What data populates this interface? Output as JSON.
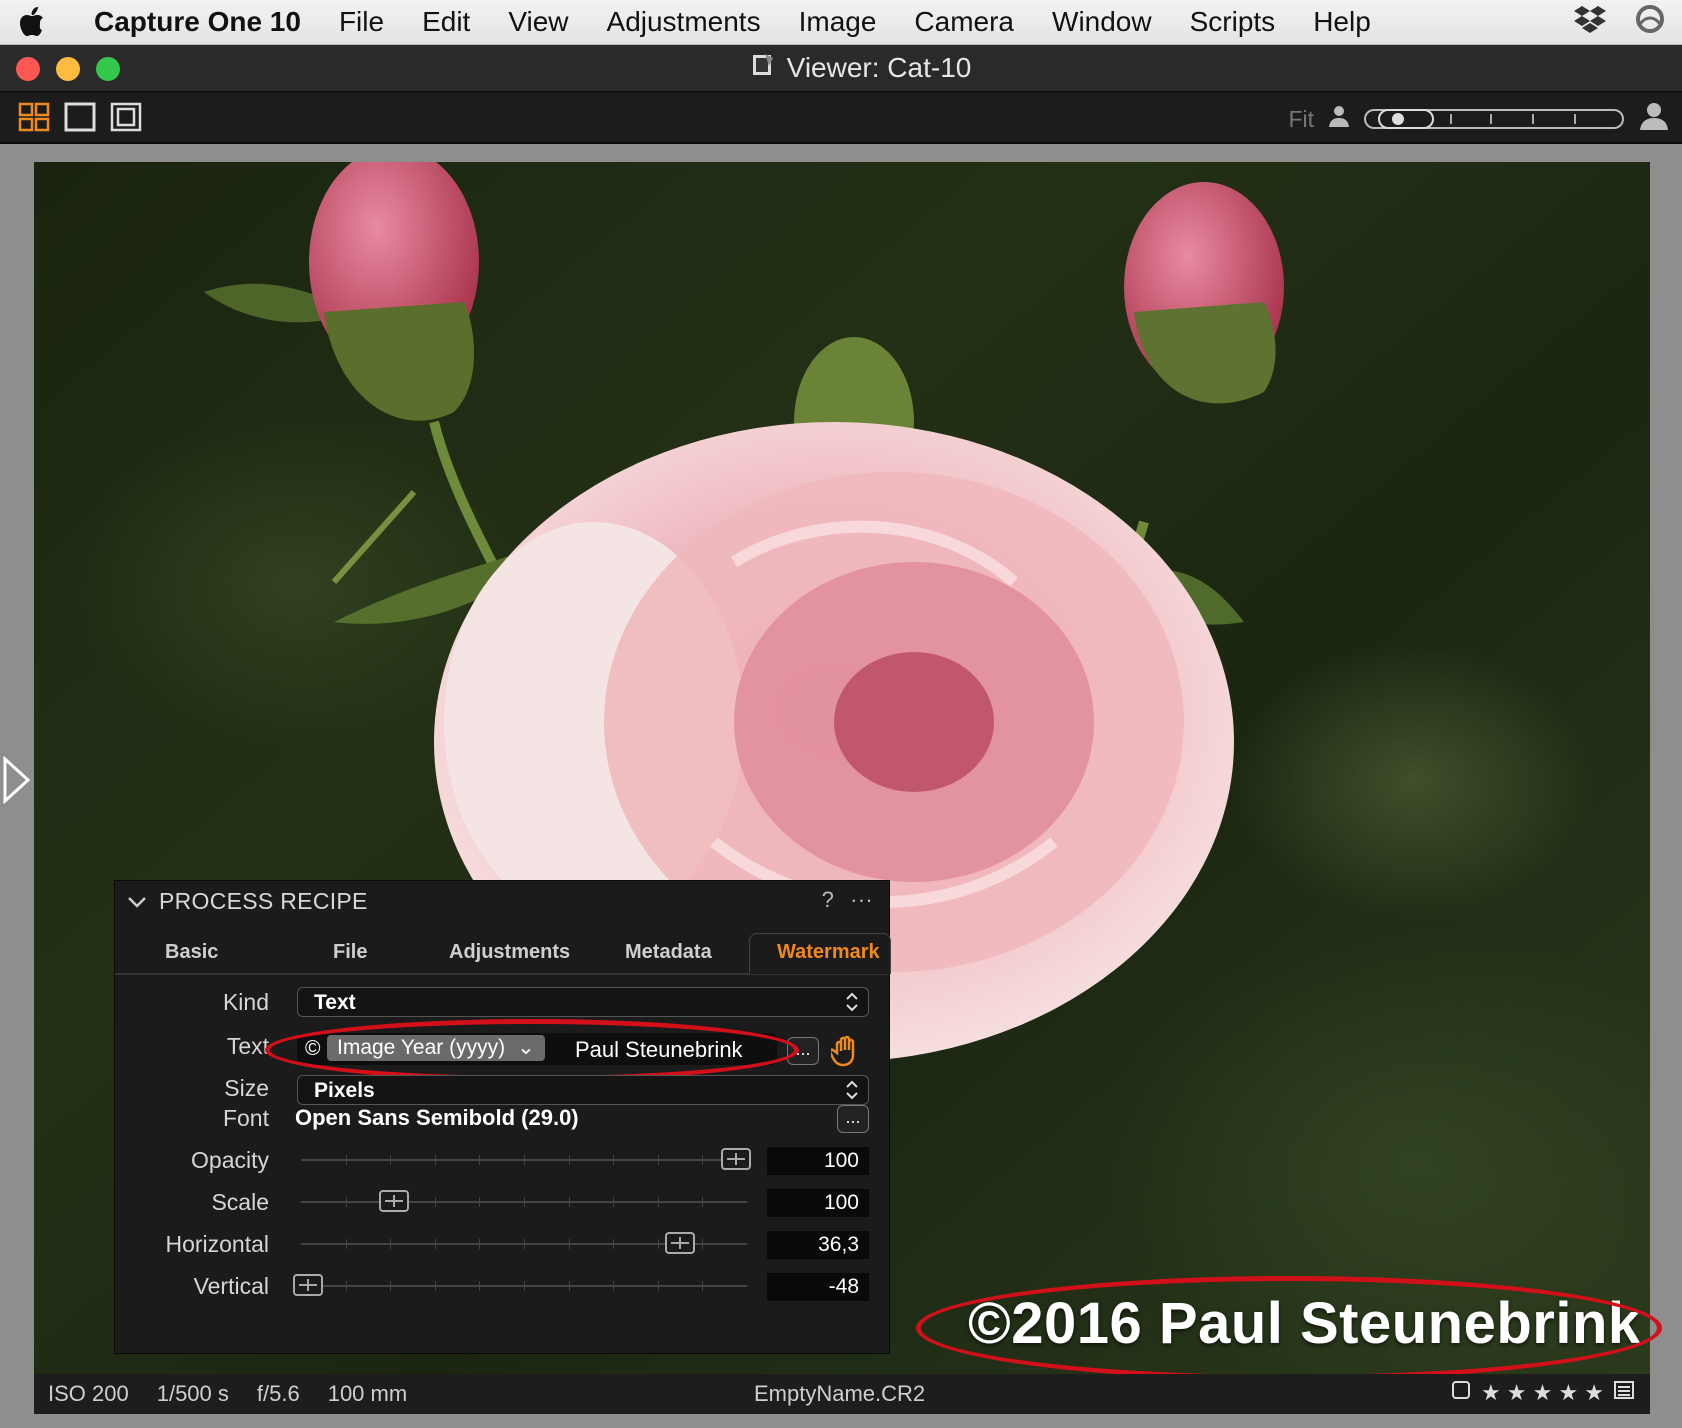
{
  "menubar": {
    "app_name": "Capture One 10",
    "items": [
      "File",
      "Edit",
      "View",
      "Adjustments",
      "Image",
      "Camera",
      "Window",
      "Scripts",
      "Help"
    ]
  },
  "window": {
    "title": "Viewer: Cat-10"
  },
  "toolbar": {
    "fit_label": "Fit",
    "zoom_level": 0.1
  },
  "watermark_overlay": {
    "text": "©2016 Paul Steunebrink"
  },
  "process_recipe": {
    "title": "PROCESS RECIPE",
    "help_label": "?",
    "more_label": "···",
    "tabs": [
      "Basic",
      "File",
      "Adjustments",
      "Metadata",
      "Watermark"
    ],
    "active_tab": "Watermark",
    "kind": {
      "label": "Kind",
      "value": "Text"
    },
    "text": {
      "label": "Text",
      "copyright_symbol": "©",
      "token": "Image Year (yyyy)",
      "token_arrow": "⌄",
      "rest": "Paul Steunebrink",
      "more_button": "..."
    },
    "size": {
      "label": "Size",
      "value": "Pixels"
    },
    "font": {
      "label": "Font",
      "value": "Open Sans Semibold (29.0)",
      "button": "..."
    },
    "opacity": {
      "label": "Opacity",
      "value": "100",
      "position": 0.99
    },
    "scale": {
      "label": "Scale",
      "value": "100",
      "position": 0.2
    },
    "horizontal": {
      "label": "Horizontal",
      "value": "36,3",
      "position": 0.86
    },
    "vertical": {
      "label": "Vertical",
      "value": "-48",
      "position": 0.0
    }
  },
  "statusbar": {
    "iso": "ISO 200",
    "shutter": "1/500 s",
    "aperture": "f/5.6",
    "focal": "100 mm",
    "filename": "EmptyName.CR2",
    "stars": "★ ★ ★ ★ ★"
  },
  "colors": {
    "accent_orange": "#f08a1c",
    "annotation_red": "#d3101a"
  }
}
